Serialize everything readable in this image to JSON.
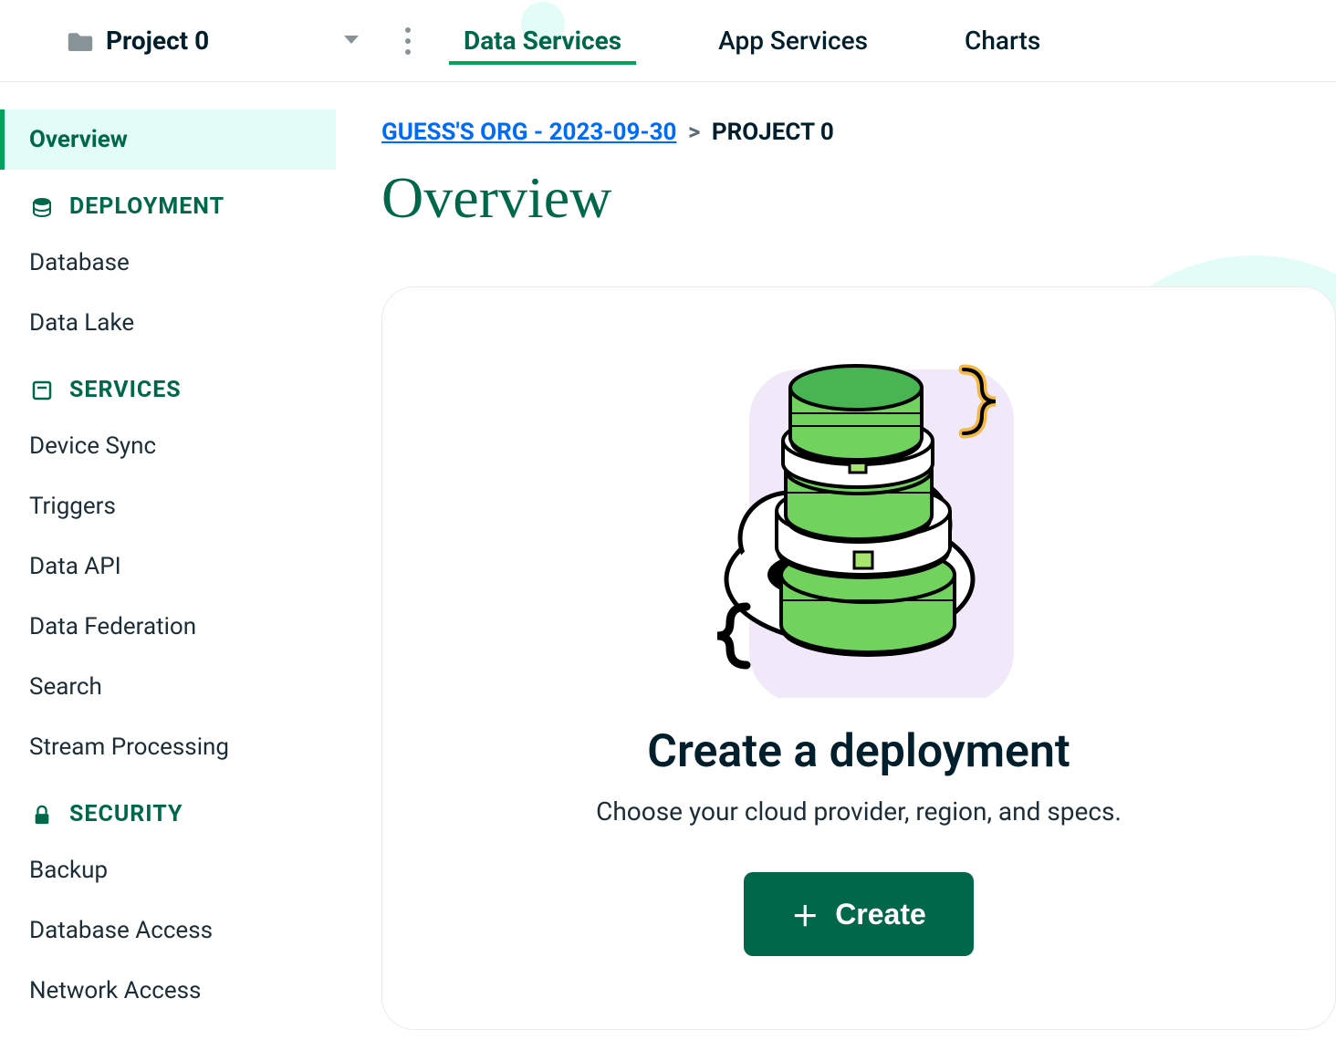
{
  "header": {
    "project_name": "Project 0",
    "tabs": [
      {
        "label": "Data Services",
        "active": true
      },
      {
        "label": "App Services",
        "active": false
      },
      {
        "label": "Charts",
        "active": false
      }
    ]
  },
  "sidebar": {
    "overview_label": "Overview",
    "sections": [
      {
        "heading": "DEPLOYMENT",
        "icon": "database-stack-icon",
        "items": [
          "Database",
          "Data Lake"
        ]
      },
      {
        "heading": "SERVICES",
        "icon": "paper-icon",
        "items": [
          "Device Sync",
          "Triggers",
          "Data API",
          "Data Federation",
          "Search",
          "Stream Processing"
        ]
      },
      {
        "heading": "SECURITY",
        "icon": "lock-icon",
        "items": [
          "Backup",
          "Database Access",
          "Network Access"
        ]
      }
    ]
  },
  "breadcrumb": {
    "org_label": "GUESS'S ORG - 2023-09-30",
    "separator": ">",
    "current": "PROJECT 0"
  },
  "page": {
    "title": "Overview"
  },
  "card": {
    "heading": "Create a deployment",
    "subtext": "Choose your cloud provider, region, and specs.",
    "button_label": "Create"
  }
}
